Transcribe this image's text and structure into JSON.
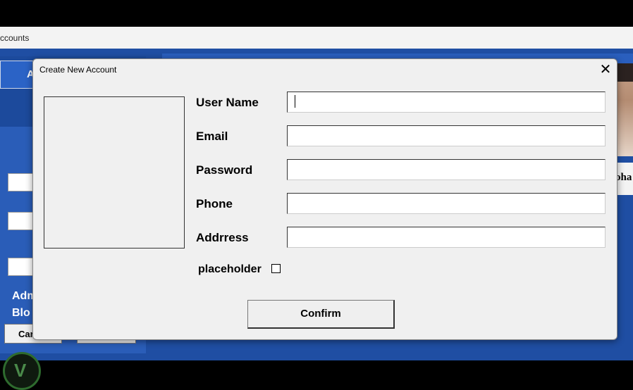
{
  "background_window": {
    "title_fragment": "ccounts",
    "accounts_button_fragment": "A",
    "admin_text_fragment_1": "Adm",
    "admin_text_fragment_2": "Blo",
    "card_button_fragment": "Car",
    "profile_name_fragment": "oha"
  },
  "dialog": {
    "title": "Create New Account",
    "close_glyph": "✕",
    "fields": [
      {
        "label": "User Name",
        "value": "",
        "placeholder": ""
      },
      {
        "label": "Email",
        "value": "",
        "placeholder": ""
      },
      {
        "label": "Password",
        "value": "",
        "placeholder": ""
      },
      {
        "label": "Phone",
        "value": "",
        "placeholder": ""
      },
      {
        "label": "Addrress",
        "value": "",
        "placeholder": ""
      }
    ],
    "checkbox": {
      "label": "placeholder",
      "checked": false
    },
    "confirm_label": "Confirm"
  },
  "colors": {
    "app_blue": "#1f4ea3",
    "dialog_bg": "#f0f0f0"
  },
  "icons": {
    "close": "close-icon",
    "logo": "app-logo-icon"
  }
}
